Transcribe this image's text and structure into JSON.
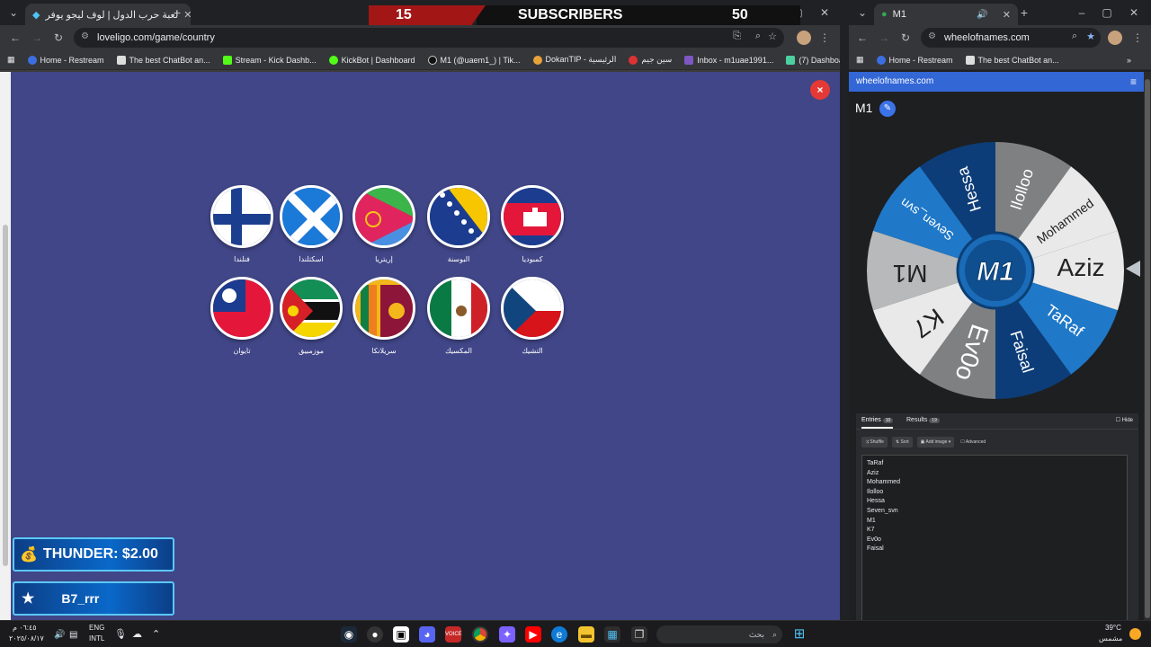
{
  "left_window": {
    "tab_title": "لعبة حرب الدول | لوف ليجو يوفر",
    "url": "loveligo.com/game/country",
    "bookmarks": [
      "Home - Restream",
      "The best ChatBot an...",
      "Stream - Kick Dashb...",
      "KickBot | Dashboard",
      "M1 (@uaem1_) | Tik...",
      "DokanTIP - الرئيسية",
      "سين جيم",
      "Inbox - m1uae1991...",
      "(7) Dashboard / Stre..."
    ],
    "subscriber_bar": {
      "current": "15",
      "label": "SUBSCRIBERS",
      "goal": "50"
    },
    "close_label": "×",
    "flags_row1": [
      {
        "label": "فنلندا",
        "icon": "finland-flag-icon"
      },
      {
        "label": "اسكتلندا",
        "icon": "scotland-flag-icon"
      },
      {
        "label": "إريتريا",
        "icon": "eritrea-flag-icon"
      },
      {
        "label": "البوسنة",
        "icon": "bosnia-flag-icon"
      },
      {
        "label": "كمبوديا",
        "icon": "cambodia-flag-icon"
      }
    ],
    "flags_row2": [
      {
        "label": "تايوان",
        "icon": "taiwan-flag-icon"
      },
      {
        "label": "موزمبيق",
        "icon": "mozambique-flag-icon"
      },
      {
        "label": "سريلانكا",
        "icon": "sri-lanka-flag-icon"
      },
      {
        "label": "المكسيك",
        "icon": "mexico-flag-icon"
      },
      {
        "label": "التشيك",
        "icon": "czech-flag-icon"
      }
    ],
    "overlay": {
      "thunder": "THUNDER: $2.00",
      "user": "B7_rrr"
    }
  },
  "right_window": {
    "tab_title": "M1",
    "url": "wheelofnames.com",
    "bookmarks": [
      "Home - Restream",
      "The best ChatBot an..."
    ],
    "site_header": "wheelofnames.com",
    "wheel_title": "M1",
    "wheel_center": "M1",
    "wheel_segments": [
      "Aziz",
      "TaRaf",
      "Faisal",
      "Ev0o",
      "K7",
      "M1",
      "Seven_svn",
      "Hessa",
      "Ilolloo",
      "Mohammed"
    ],
    "tabs": {
      "entries": "Entries",
      "entries_count": "10",
      "results": "Results",
      "results_count": "19",
      "hide": "Hide"
    },
    "toolbar": {
      "shuffle": "Shuffle",
      "sort": "Sort",
      "add_image": "Add image",
      "advanced": "Advanced"
    },
    "entries": [
      "TaRaf",
      "Aziz",
      "Mohammed",
      "Ilolloo",
      "Hessa",
      "Seven_svn",
      "M1",
      "K7",
      "Ev0o",
      "Faisal"
    ]
  },
  "taskbar": {
    "time": "٠٦:٤٥ م",
    "date": "٢٠٢٥/٠٨/١٧",
    "lang": "ENG",
    "lang2": "INTL",
    "search_placeholder": "بحث",
    "weather_temp": "39°C",
    "weather_desc": "مشمس"
  }
}
